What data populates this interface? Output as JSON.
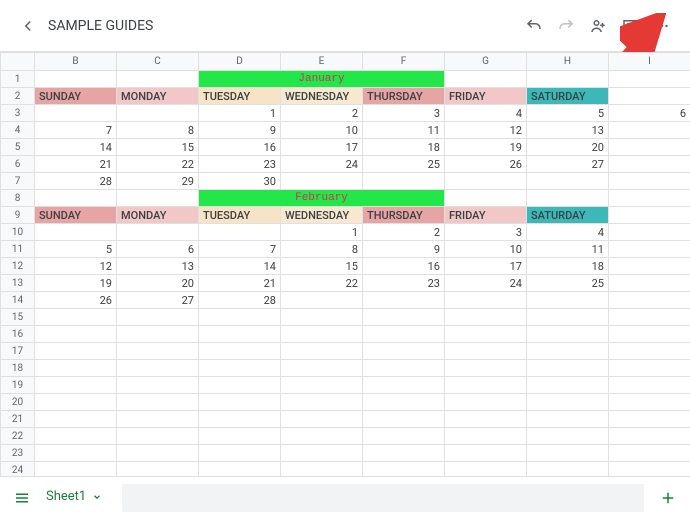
{
  "header": {
    "title": "SAMPLE GUIDES"
  },
  "columns": [
    "B",
    "C",
    "D",
    "E",
    "F",
    "G",
    "H",
    "I"
  ],
  "rows": [
    "1",
    "2",
    "3",
    "4",
    "5",
    "6",
    "7",
    "8",
    "9",
    "10",
    "11",
    "12",
    "13",
    "14",
    "15",
    "16",
    "17",
    "18",
    "19",
    "20",
    "21",
    "22",
    "23",
    "24"
  ],
  "months": {
    "jan": "January",
    "feb": "February"
  },
  "days": {
    "sun": "SUNDAY",
    "mon": "MONDAY",
    "tue": "TUESDAY",
    "wed": "WEDNESDAY",
    "thu": "THURSDAY",
    "fri": "FRIDAY",
    "sat": "SATURDAY"
  },
  "jan_grid": [
    [
      "",
      "",
      "1",
      "2",
      "3",
      "4",
      "5",
      "6"
    ],
    [
      "7",
      "8",
      "9",
      "10",
      "11",
      "12",
      "13",
      ""
    ],
    [
      "14",
      "15",
      "16",
      "17",
      "18",
      "19",
      "20",
      ""
    ],
    [
      "21",
      "22",
      "23",
      "24",
      "25",
      "26",
      "27",
      ""
    ],
    [
      "28",
      "29",
      "30",
      "",
      "",
      "",
      "",
      ""
    ]
  ],
  "feb_grid": [
    [
      "",
      "",
      "",
      "1",
      "2",
      "3",
      "4",
      ""
    ],
    [
      "5",
      "6",
      "7",
      "8",
      "9",
      "10",
      "11",
      ""
    ],
    [
      "12",
      "13",
      "14",
      "15",
      "16",
      "17",
      "18",
      ""
    ],
    [
      "19",
      "20",
      "21",
      "22",
      "23",
      "24",
      "25",
      ""
    ],
    [
      "26",
      "27",
      "28",
      "",
      "",
      "",
      "",
      ""
    ]
  ],
  "footer": {
    "tab": "Sheet1"
  }
}
